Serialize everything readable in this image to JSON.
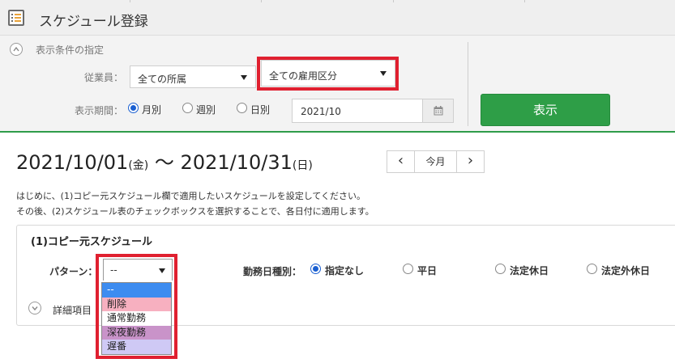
{
  "window": {
    "title": "スケジュール登録"
  },
  "filter": {
    "section_title": "表示条件の指定",
    "employee_label": "従業員：",
    "department_value": "全ての所属",
    "employment_type_value": "全ての雇用区分",
    "period_label": "表示期間：",
    "period_options": [
      {
        "label": "月別",
        "selected": true
      },
      {
        "label": "週別",
        "selected": false
      },
      {
        "label": "日別",
        "selected": false
      }
    ],
    "date_value": "2021/10",
    "show_button": "表示"
  },
  "period": {
    "start_date": "2021/10/01",
    "start_day": "(金)",
    "separator": "〜",
    "end_date": "2021/10/31",
    "end_day": "(日)",
    "prev": "‹",
    "today": "今月",
    "next": "›"
  },
  "instructions": [
    "はじめに、(1)コピー元スケジュール欄で適用したいスケジュールを設定してください。",
    "その後、(2)スケジュール表のチェックボックスを選択することで、各日付に適用します。"
  ],
  "copy_source": {
    "title": "(1)コピー元スケジュール",
    "pattern_label": "パターン：",
    "pattern_value": "--",
    "work_type_label": "勤務日種別：",
    "work_type_options": [
      {
        "label": "指定なし",
        "selected": true
      },
      {
        "label": "平日",
        "selected": false
      },
      {
        "label": "法定休日",
        "selected": false
      },
      {
        "label": "法定外休日",
        "selected": false
      }
    ],
    "details_label": "詳細項目"
  },
  "pattern_dropdown": {
    "options": [
      {
        "label": "--",
        "bg": "#3d8cf0",
        "color": "#ffffff"
      },
      {
        "label": "削除",
        "bg": "#f7b0c0",
        "color": "#222222"
      },
      {
        "label": "通常勤務",
        "bg": "#ffffff",
        "color": "#222222"
      },
      {
        "label": "深夜勤務",
        "bg": "#c993c9",
        "color": "#222222"
      },
      {
        "label": "遅番",
        "bg": "#cfc9f5",
        "color": "#222222"
      }
    ]
  },
  "colors": {
    "accent_green": "#2e9e47",
    "highlight_red": "#e02030",
    "radio_blue": "#1a5fd1"
  }
}
